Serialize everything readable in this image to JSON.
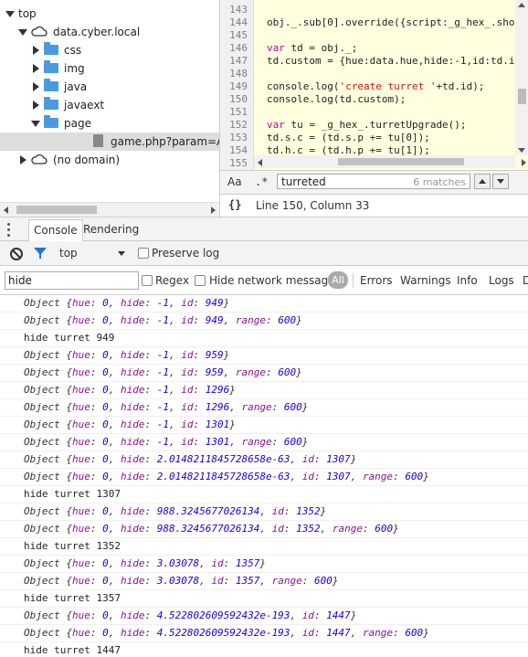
{
  "tree": {
    "items": [
      {
        "label": "top",
        "icon": "none",
        "expanded": true
      },
      {
        "label": "data.cyber.local",
        "icon": "cloud",
        "expanded": true
      },
      {
        "label": "css",
        "icon": "folder",
        "expanded": false
      },
      {
        "label": "img",
        "icon": "folder",
        "expanded": false
      },
      {
        "label": "java",
        "icon": "folder",
        "expanded": false
      },
      {
        "label": "javaext",
        "icon": "folder",
        "expanded": false
      },
      {
        "label": "page",
        "icon": "folder",
        "expanded": true
      },
      {
        "label": "game.php?param=AntiMinerT_",
        "icon": "file",
        "selected": true
      },
      {
        "label": "(no domain)",
        "icon": "cloud",
        "expanded": false
      }
    ]
  },
  "editor": {
    "lines": [
      {
        "n": "143",
        "code": "  ",
        "partial": "}},"
      },
      {
        "n": "144",
        "code": "obj._.sub[0].override({script:_g_hex_.sho"
      },
      {
        "n": "145",
        "code": ""
      },
      {
        "n": "146",
        "code": "var td = obj._;"
      },
      {
        "n": "147",
        "code": "td.custom = {hue:data.hue,hide:-1,id:td.i"
      },
      {
        "n": "148",
        "code": ""
      },
      {
        "n": "149",
        "code": "console.log('create turret '+td.id);"
      },
      {
        "n": "150",
        "code": "console.log(td.custom);"
      },
      {
        "n": "151",
        "code": ""
      },
      {
        "n": "152",
        "code": "var tu = _g_hex_.turretUpgrade();"
      },
      {
        "n": "153",
        "code": "td.s.c = (td.s.p += tu[0]);"
      },
      {
        "n": "154",
        "code": "td.h.c = (td.h.p += tu[1]);"
      },
      {
        "n": "155",
        "code": ""
      }
    ],
    "search": {
      "case_label": "Aa",
      "regex_label": ".*",
      "query": "turreted",
      "matches": "6 matches"
    },
    "status": {
      "braces": "{}",
      "position": "Line 150, Column 33"
    }
  },
  "drawer": {
    "tabs": [
      {
        "label": "Console",
        "active": true
      },
      {
        "label": "Rendering",
        "active": false
      }
    ]
  },
  "console_toolbar": {
    "context": "top",
    "preserve_log": "Preserve log"
  },
  "filter_bar": {
    "filter_value": "hide",
    "regex_label": "Regex",
    "hide_network_label": "Hide network messages",
    "all_label": "All",
    "levels": [
      "Errors",
      "Warnings",
      "Info",
      "Logs",
      "D"
    ]
  },
  "logs": [
    {
      "type": "obj",
      "hue": "0",
      "hide": "-1",
      "id": "949",
      "range": null
    },
    {
      "type": "obj",
      "hue": "0",
      "hide": "-1",
      "id": "949",
      "range": "600"
    },
    {
      "type": "text",
      "text": "hide turret 949"
    },
    {
      "type": "obj",
      "hue": "0",
      "hide": "-1",
      "id": "959",
      "range": null
    },
    {
      "type": "obj",
      "hue": "0",
      "hide": "-1",
      "id": "959",
      "range": "600"
    },
    {
      "type": "obj",
      "hue": "0",
      "hide": "-1",
      "id": "1296",
      "range": null
    },
    {
      "type": "obj",
      "hue": "0",
      "hide": "-1",
      "id": "1296",
      "range": "600"
    },
    {
      "type": "obj",
      "hue": "0",
      "hide": "-1",
      "id": "1301",
      "range": null
    },
    {
      "type": "obj",
      "hue": "0",
      "hide": "-1",
      "id": "1301",
      "range": "600"
    },
    {
      "type": "obj",
      "hue": "0",
      "hide": "2.0148211845728658e-63",
      "id": "1307",
      "range": null
    },
    {
      "type": "obj",
      "hue": "0",
      "hide": "2.0148211845728658e-63",
      "id": "1307",
      "range": "600"
    },
    {
      "type": "text",
      "text": "hide turret 1307"
    },
    {
      "type": "obj",
      "hue": "0",
      "hide": "988.3245677026134",
      "id": "1352",
      "range": null
    },
    {
      "type": "obj",
      "hue": "0",
      "hide": "988.3245677026134",
      "id": "1352",
      "range": "600"
    },
    {
      "type": "text",
      "text": "hide turret 1352"
    },
    {
      "type": "obj",
      "hue": "0",
      "hide": "3.03078",
      "id": "1357",
      "range": null
    },
    {
      "type": "obj",
      "hue": "0",
      "hide": "3.03078",
      "id": "1357",
      "range": "600"
    },
    {
      "type": "text",
      "text": "hide turret 1357"
    },
    {
      "type": "obj",
      "hue": "0",
      "hide": "4.522802609592432e-193",
      "id": "1447",
      "range": null
    },
    {
      "type": "obj",
      "hue": "0",
      "hide": "4.522802609592432e-193",
      "id": "1447",
      "range": "600"
    },
    {
      "type": "text",
      "text": "hide turret 1447"
    }
  ]
}
